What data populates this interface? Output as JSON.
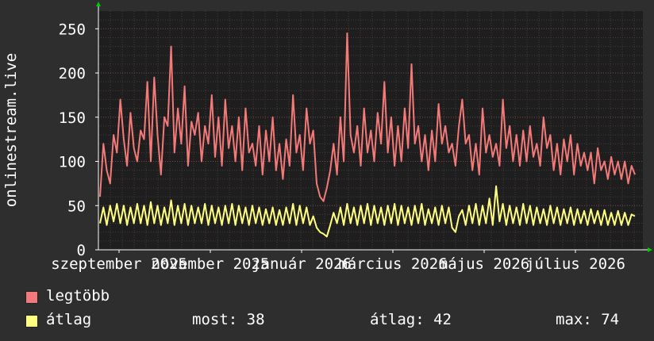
{
  "chart_data": {
    "type": "line",
    "ylabel": "onlinestream.live",
    "ylim": [
      0,
      270
    ],
    "yticks": [
      0,
      50,
      100,
      150,
      200,
      250
    ],
    "x_tick_labels": [
      "szeptember 2025",
      "november 2025",
      "január 2026",
      "március 2026",
      "május 2026",
      "július 2026"
    ],
    "grid": true,
    "background": "#1e1e1e",
    "series": [
      {
        "name": "legtöbb",
        "color": "#f47a7a",
        "values": [
          60,
          120,
          90,
          75,
          130,
          110,
          170,
          125,
          95,
          155,
          115,
          100,
          135,
          125,
          190,
          100,
          195,
          130,
          85,
          150,
          140,
          230,
          110,
          160,
          120,
          185,
          95,
          145,
          130,
          155,
          100,
          140,
          120,
          175,
          105,
          150,
          95,
          170,
          115,
          140,
          100,
          150,
          90,
          160,
          110,
          120,
          95,
          140,
          85,
          135,
          100,
          150,
          90,
          120,
          80,
          125,
          95,
          175,
          110,
          130,
          90,
          160,
          120,
          135,
          75,
          60,
          55,
          70,
          90,
          120,
          85,
          150,
          100,
          245,
          130,
          110,
          140,
          95,
          160,
          110,
          135,
          100,
          155,
          120,
          190,
          110,
          150,
          95,
          140,
          100,
          160,
          115,
          210,
          120,
          140,
          100,
          130,
          90,
          135,
          100,
          165,
          120,
          140,
          110,
          120,
          95,
          140,
          170,
          120,
          130,
          90,
          120,
          85,
          160,
          110,
          130,
          105,
          120,
          95,
          170,
          115,
          140,
          100,
          130,
          95,
          135,
          100,
          140,
          105,
          120,
          95,
          150,
          115,
          130,
          90,
          120,
          85,
          125,
          100,
          130,
          85,
          120,
          95,
          110,
          90,
          110,
          75,
          115,
          90,
          100,
          80,
          105,
          85,
          100,
          80,
          100,
          75,
          95,
          85
        ]
      },
      {
        "name": "átlag",
        "color": "#ffff80",
        "values": [
          30,
          48,
          28,
          50,
          32,
          52,
          30,
          50,
          28,
          48,
          30,
          52,
          30,
          50,
          28,
          54,
          30,
          50,
          28,
          48,
          30,
          56,
          28,
          50,
          30,
          52,
          28,
          50,
          30,
          48,
          30,
          52,
          28,
          50,
          30,
          48,
          28,
          50,
          30,
          52,
          28,
          50,
          30,
          48,
          28,
          50,
          30,
          48,
          28,
          46,
          30,
          48,
          28,
          45,
          28,
          48,
          30,
          52,
          28,
          50,
          30,
          48,
          28,
          38,
          25,
          20,
          18,
          15,
          28,
          42,
          30,
          48,
          28,
          52,
          30,
          48,
          28,
          50,
          30,
          52,
          28,
          50,
          30,
          48,
          28,
          50,
          30,
          52,
          28,
          50,
          30,
          48,
          28,
          50,
          30,
          52,
          28,
          46,
          30,
          48,
          28,
          50,
          30,
          48,
          25,
          20,
          38,
          45,
          28,
          50,
          30,
          52,
          28,
          50,
          30,
          58,
          28,
          72,
          32,
          52,
          28,
          50,
          30,
          48,
          28,
          52,
          30,
          50,
          28,
          48,
          30,
          46,
          28,
          50,
          30,
          48,
          28,
          46,
          30,
          48,
          28,
          46,
          30,
          44,
          28,
          46,
          30,
          44,
          28,
          45,
          28,
          42,
          28,
          44,
          28,
          42,
          28,
          40,
          38
        ]
      }
    ],
    "stats": {
      "most_label": "most:",
      "most": "38",
      "avg_label": "átlag:",
      "avg": "42",
      "max_label": "max:",
      "max": "74"
    }
  }
}
